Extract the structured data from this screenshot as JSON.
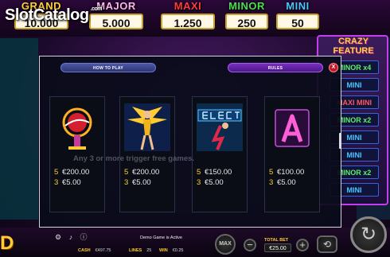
{
  "watermark": {
    "text": "SlotCatalog",
    "suffix": ".com"
  },
  "jackpots": [
    {
      "label": "GRAND",
      "value": "10.000"
    },
    {
      "label": "MAJOR",
      "value": "5.000"
    },
    {
      "label": "MAXI",
      "value": "1.250"
    },
    {
      "label": "MINOR",
      "value": "250"
    },
    {
      "label": "MINI",
      "value": "50"
    }
  ],
  "crazy_feature": {
    "title_line1": "CRAZY",
    "title_line2": "FEATURE",
    "items": [
      "MINOR x4",
      "MINI",
      "MAXI MINI",
      "MINOR x2",
      "MINI",
      "MINI",
      "MINOR x2",
      "MINI"
    ]
  },
  "modal": {
    "tab_how_to_play": "HOW TO PLAY",
    "tab_rules": "RULES",
    "close_label": "X",
    "hint_text": "Any 3 or more trigger free games.",
    "symbols": [
      {
        "icon": "vegas-sign-icon",
        "pays": [
          {
            "count": "5",
            "amount": "€200.00"
          },
          {
            "count": "3",
            "amount": "€5.00"
          }
        ]
      },
      {
        "icon": "showgirl-icon",
        "pays": [
          {
            "count": "5",
            "amount": "€200.00"
          },
          {
            "count": "3",
            "amount": "€5.00"
          }
        ]
      },
      {
        "icon": "electric-sign-icon",
        "pays": [
          {
            "count": "5",
            "amount": "€150.00"
          },
          {
            "count": "3",
            "amount": "€5.00"
          }
        ]
      },
      {
        "icon": "letter-a-icon",
        "pays": [
          {
            "count": "5",
            "amount": "€100.00"
          },
          {
            "count": "3",
            "amount": "€5.00"
          }
        ]
      }
    ]
  },
  "bottom_bar": {
    "logo_text": "D",
    "demo_text": "Demo Game is Active",
    "cash_label": "CASH",
    "cash_value": "€497.75",
    "lines_label": "LINES",
    "lines_value": "25",
    "win_label": "WIN",
    "win_value": "€0.25",
    "max_label": "MAX",
    "total_bet_label": "TOTAL BET",
    "total_bet_value": "€25.00"
  },
  "colors": {
    "modal_bg": "#0a0c1a",
    "tab_rules": "#7a2fc0",
    "tab_how": "#4b57a8",
    "gold": "#ffcc33",
    "close": "#c4142a"
  }
}
